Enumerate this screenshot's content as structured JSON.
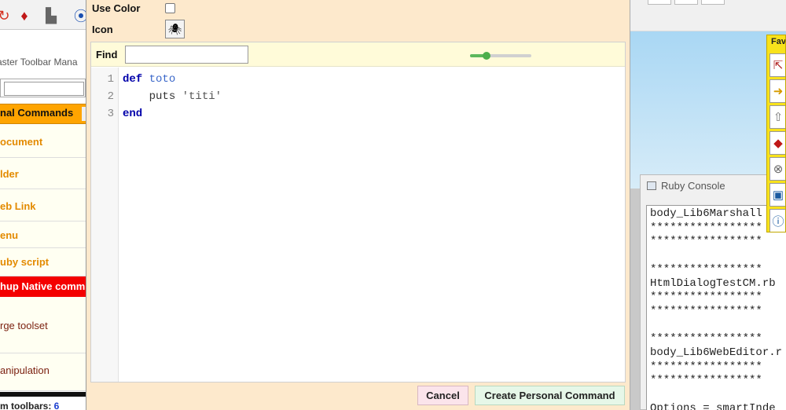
{
  "toolbar_manager": {
    "title": "aster Toolbar Mana",
    "section_header": "nal Commands",
    "items": [
      {
        "label": "ocument"
      },
      {
        "label": "lder"
      },
      {
        "label": "eb Link"
      },
      {
        "label": "enu"
      },
      {
        "label": "uby script"
      }
    ],
    "native_header": "hup Native comm",
    "native_items": [
      {
        "label": "rge toolset"
      },
      {
        "label": "anipulation"
      }
    ],
    "footer_label": "m toolbars: ",
    "footer_count": "6",
    "icons": [
      "redo-arrow-icon",
      "ruby-gem-icon",
      "sandbox-icon",
      "location-pin-icon"
    ]
  },
  "dialog": {
    "use_color_label": "Use Color",
    "use_color_checked": false,
    "icon_label": "Icon",
    "icon_name": "bug-icon",
    "find_label": "Find",
    "find_value": "",
    "zoom_level": 0.27,
    "code": {
      "line_numbers": [
        "1",
        "2",
        "3"
      ],
      "line1_kw": "def",
      "line1_name": "toto",
      "line2_call": "puts",
      "line2_str": "'titi'",
      "line3_kw": "end"
    },
    "cancel_label": "Cancel",
    "create_label": "Create Personal Command"
  },
  "ruby_console": {
    "title": "Ruby Console",
    "lines": [
      "body_Lib6Marshall",
      "*****************",
      "*****************",
      "",
      "*****************",
      "HtmlDialogTestCM.rb",
      "*****************",
      "*****************",
      "",
      "*****************",
      "body_Lib6WebEditor.r",
      "*****************",
      "*****************",
      "",
      "Options = smartInde"
    ]
  },
  "favorites": {
    "title": "Fave",
    "icons": [
      "export-icon",
      "arrow-right-icon",
      "rocket-icon",
      "ruby-cube-icon",
      "cancel-circle-icon",
      "window-info-icon",
      "tools-info-icon"
    ]
  },
  "colors": {
    "dialog_bg": "#fde9cc",
    "section_orange": "#ffa400",
    "native_red": "#f40000",
    "keyword_blue": "#0000aa",
    "favorites_yellow": "#f8e21c"
  }
}
